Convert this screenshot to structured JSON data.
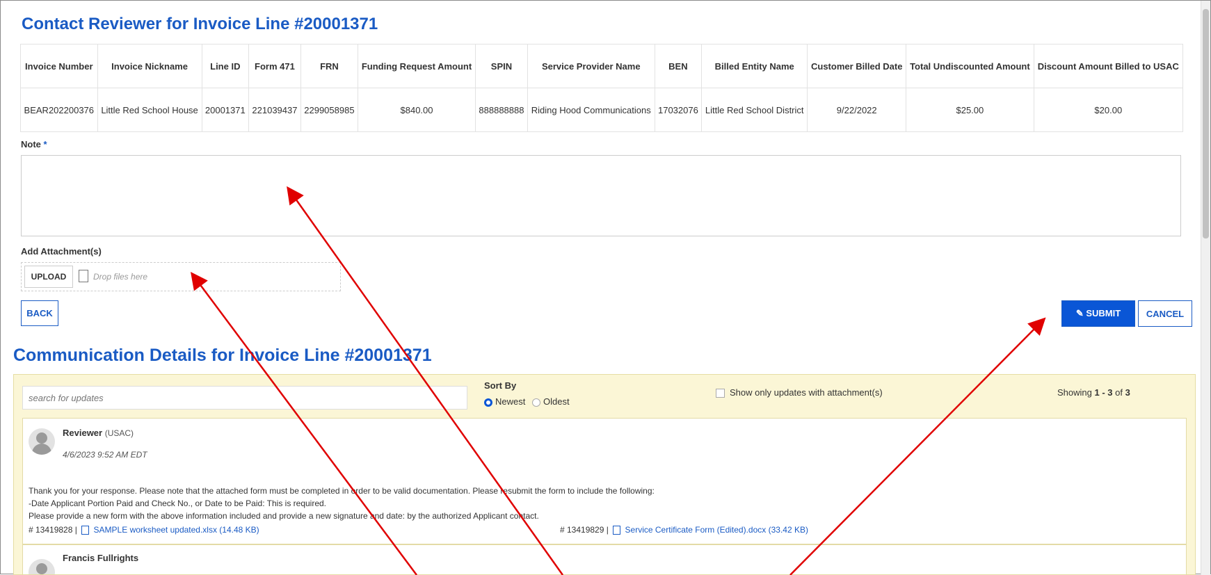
{
  "page": {
    "title": "Contact Reviewer for Invoice Line #20001371",
    "comm_title": "Communication Details for Invoice Line #20001371"
  },
  "table": {
    "headers": [
      "Invoice Number",
      "Invoice Nickname",
      "Line ID",
      "Form 471",
      "FRN",
      "Funding Request Amount",
      "SPIN",
      "Service Provider Name",
      "BEN",
      "Billed Entity Name",
      "Customer Billed Date",
      "Total Undiscounted Amount",
      "Discount Amount Billed to USAC"
    ],
    "row": [
      "BEAR202200376",
      "Little Red School House",
      "20001371",
      "221039437",
      "2299058985",
      "$840.00",
      "888888888",
      "Riding Hood Communications",
      "17032076",
      "Little Red School District",
      "9/22/2022",
      "$25.00",
      "$20.00"
    ]
  },
  "form": {
    "note_label": "Note",
    "required_mark": "*",
    "note_value": "",
    "attach_label": "Add Attachment(s)",
    "upload_label": "UPLOAD",
    "drop_hint": "Drop files here",
    "back_label": "BACK",
    "submit_label": "SUBMIT",
    "cancel_label": "CANCEL"
  },
  "comm": {
    "search_placeholder": "search for updates",
    "sort_by_label": "Sort By",
    "sort_newest": "Newest",
    "sort_oldest": "Oldest",
    "sort_selected": "Newest",
    "attachment_filter_label": "Show only updates with attachment(s)",
    "attachment_filter_checked": false,
    "showing_prefix": "Showing ",
    "showing_range": "1 - 3",
    "showing_mid": " of ",
    "showing_total": "3"
  },
  "updates": [
    {
      "author": "Reviewer",
      "org": "(USAC)",
      "timestamp": "4/6/2023 9:52 AM EDT",
      "message_lines": [
        "Thank you for your response. Please note that the attached form must be completed in order to be valid documentation. Please resubmit the form to include the following:",
        "-Date Applicant Portion Paid and Check No., or Date to be Paid: This is required.",
        "Please provide a new form with the above information included and provide a new signature and date: by the authorized Applicant contact."
      ],
      "attachments": [
        {
          "id": "# 13419828 |",
          "name": "SAMPLE worksheet updated.xlsx (14.48 KB)",
          "icon": "excel-file-icon"
        },
        {
          "id": "# 13419829 |",
          "name": "Service Certificate Form (Edited).docx (33.42 KB)",
          "icon": "word-file-icon"
        }
      ]
    },
    {
      "author": "Francis Fullrights"
    }
  ],
  "colors": {
    "accent": "#1a5bc4",
    "submit_bg": "#0a56d6",
    "comm_bg": "#fbf6d6",
    "annotation_arrow": "#e00000"
  }
}
